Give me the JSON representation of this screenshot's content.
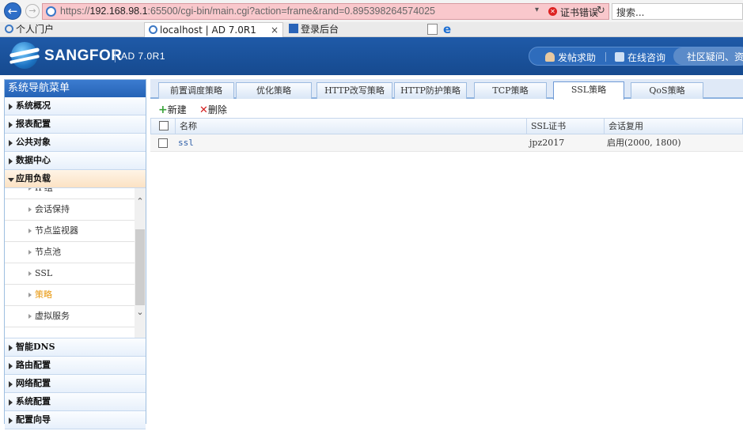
{
  "browser": {
    "url_prefix": "https://",
    "url_host": "192.168.98.1",
    "url_rest": ":65500/cgi-bin/main.cgi?action=frame&rand=0.895398264574025",
    "cert_error": "证书错误",
    "search_placeholder": "搜索...",
    "favorites": [
      "个人门户"
    ],
    "tabs": [
      {
        "title": "localhost | AD 7.0R1"
      },
      {
        "title": "登录后台"
      }
    ]
  },
  "header": {
    "brand": "SANGFOR",
    "product": "AD 7.0R1",
    "links": [
      "发帖求助",
      "在线咨询",
      "社区疑问、资料"
    ]
  },
  "sidebar": {
    "title": "系统导航菜单",
    "items_top": [
      "系统概况",
      "报表配置",
      "公共对象",
      "数据中心",
      "应用负载"
    ],
    "sub_items": [
      "IP组",
      "会话保持",
      "节点监视器",
      "节点池",
      "SSL",
      "策略",
      "虚拟服务"
    ],
    "selected_sub": "策略",
    "items_bottom": [
      "智能DNS",
      "路由配置",
      "网络配置",
      "系统配置",
      "配置向导"
    ]
  },
  "main": {
    "tabs": [
      "前置调度策略",
      "优化策略",
      "HTTP改写策略",
      "HTTP防护策略",
      "TCP策略",
      "SSL策略",
      "QoS策略"
    ],
    "active_tab": "SSL策略",
    "toolbar": {
      "new_label": "新建",
      "delete_label": "删除"
    },
    "columns": [
      "名称",
      "SSL证书",
      "会话复用"
    ],
    "rows": [
      {
        "name": "ssl",
        "cert": "jpz2017",
        "reuse": "启用(2000, 1800)"
      }
    ]
  },
  "colors": {
    "header_blue": "#1f5aa8",
    "selected_orange": "#e8970c",
    "url_error_bg": "#f9c8cc"
  }
}
